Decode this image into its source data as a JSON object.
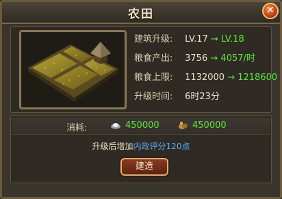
{
  "window": {
    "title": "农田",
    "close_symbol": "✕"
  },
  "building": {
    "image_icon": "farm-field-building",
    "stats": [
      {
        "label": "建筑升级:",
        "current": "LV.17",
        "next": "LV.18"
      },
      {
        "label": "粮食产出:",
        "current": "3756",
        "next": "4057/时"
      },
      {
        "label": "粮食上限:",
        "current": "1132000",
        "next": "1218600"
      },
      {
        "label": "升级时间:",
        "value": "6时23分"
      }
    ],
    "arrow": "→"
  },
  "cost": {
    "label": "消耗:",
    "items": [
      {
        "icon": "silver-ingot-icon",
        "value": "450000"
      },
      {
        "icon": "food-sack-icon",
        "value": "450000"
      }
    ]
  },
  "bonus": {
    "prefix": "升级后增加",
    "highlight": "内政评分120点"
  },
  "actions": {
    "build_label": "建造"
  },
  "colors": {
    "upgrade_green": "#5ee53f",
    "highlight_blue": "#5da9ff"
  }
}
